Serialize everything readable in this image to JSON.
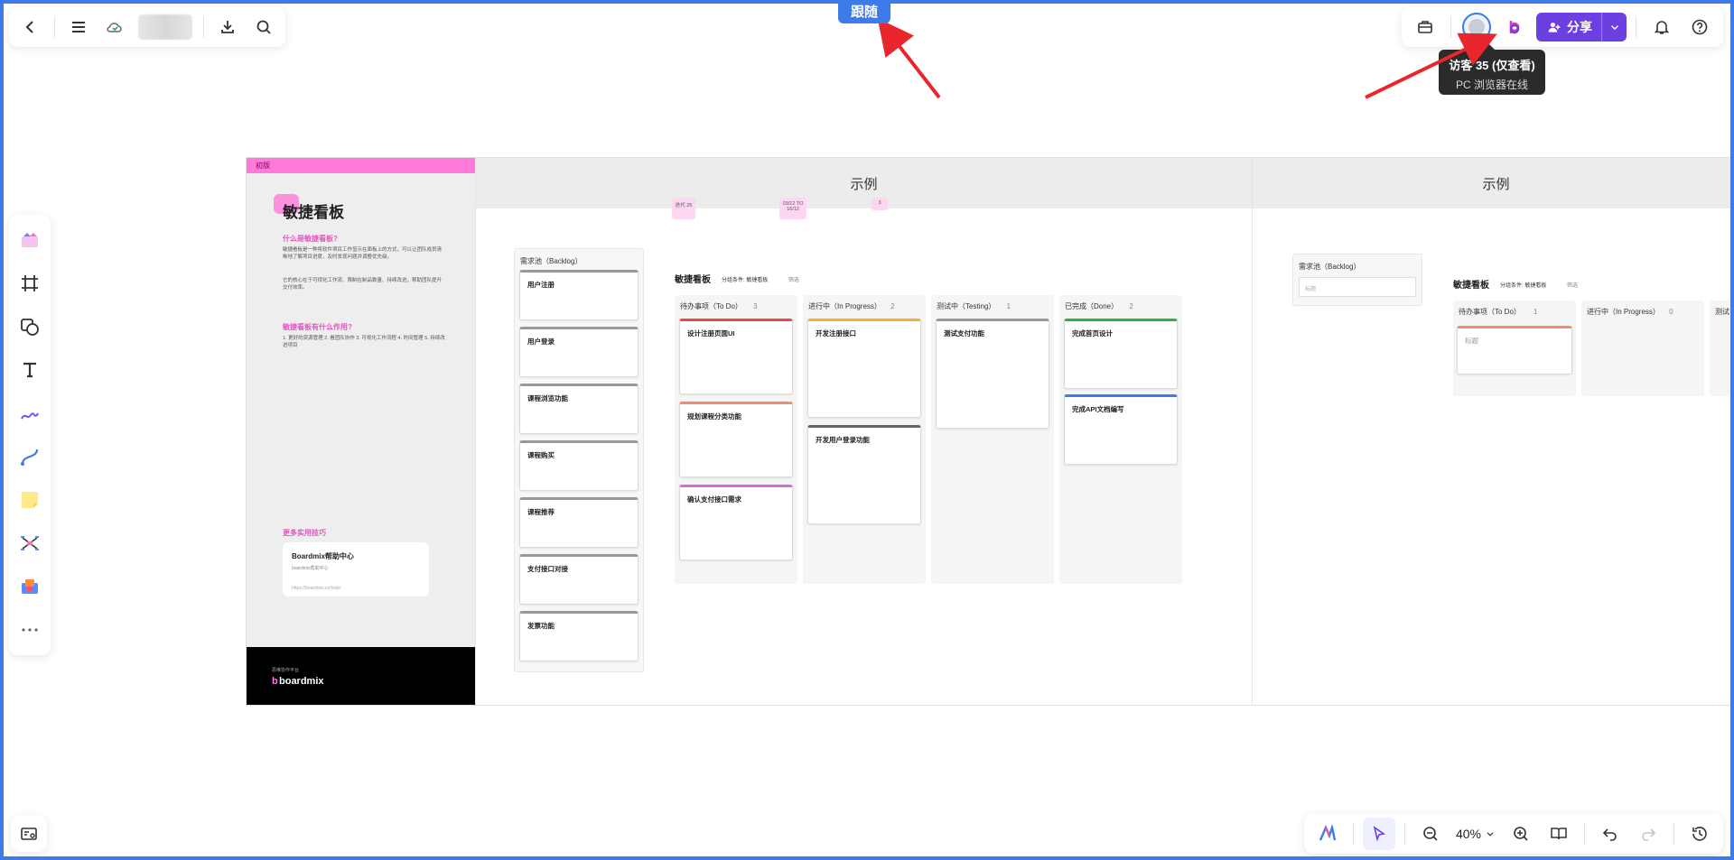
{
  "follow_label": "跟随",
  "top_bar": {
    "back_icon": "arrow-left-icon",
    "menu_icon": "hamburger-icon",
    "cloud_icon": "cloud-check-icon",
    "export_icon": "download-icon",
    "search_icon": "search-icon"
  },
  "top_right": {
    "share_label": "分享",
    "tooltip_title": "访客 35 (仅查看)",
    "tooltip_sub": "PC 浏览器在线"
  },
  "bottom_right": {
    "zoom": "40%"
  },
  "board": {
    "intro": {
      "header_tag": "初版",
      "title": "敏捷看板",
      "sec1": "什么是敏捷看板?",
      "para1": "敏捷看板是一种将软件项目工作显示在面板上的方式，可以让团队成员清晰地了解项目进度，及时发现问题并调整优先级。",
      "para2": "它的核心在于可视化工作流、限制在制品数量、持续改进，帮助团队提升交付效率。",
      "sec2": "敏捷看板有什么作用?",
      "para3": "1. 更好的资源管理 2. 看团队协作 3. 可视化工作流程 4. 时间管理 5. 持续改进项目",
      "sec3": "更多实用技巧",
      "help_title": "Boardmix帮助中心",
      "help_sub": "boardmix帮助中心",
      "help_link": "https://boardmix.cn/help/",
      "footer_small": "思维协作平台",
      "footer_brand": "boardmix"
    },
    "section_title_1": "示例",
    "section_title_2": "示例",
    "backlog_title": "需求池（Backlog）",
    "kanban_title": "敏捷看板",
    "group_label": "分组条件: 敏捷看板",
    "filter_label": "筛选",
    "lane_todo": "待办事项（To Do）",
    "lane_todo_count": "3",
    "lane_inprogress": "进行中（In Progress）",
    "lane_inprogress_count": "2",
    "lane_testing": "测试中（Testing）",
    "lane_testing_count": "1",
    "lane_done": "已完成（Done）",
    "lane_done_count": "2",
    "backlog_cards": [
      "用户注册",
      "用户登录",
      "课程浏览功能",
      "课程购买",
      "课程推荐",
      "支付接口对接",
      "发票功能"
    ],
    "todo_cards": [
      "设计注册页面UI",
      "规划课程分类功能",
      "确认支付接口需求"
    ],
    "inprogress_cards": [
      "开发注册接口",
      "开发用户登录功能"
    ],
    "testing_cards": [
      "测试支付功能"
    ],
    "done_cards": [
      "完成首页设计",
      "完成API文档编写"
    ],
    "pink_1": "迭代 25",
    "pink_2": "03/12 TO 16/12",
    "pink_3": "3",
    "backlog2_title": "需求池（Backlog）",
    "backlog2_placeholder": "标题",
    "kanban2_title": "敏捷看板",
    "group2_label": "分组条件: 敏捷看板",
    "filter2_label": "筛选",
    "lane2_todo": "待办事项（To Do）",
    "lane2_todo_count": "1",
    "lane2_inprogress": "进行中（In Progress）",
    "lane2_inprogress_count": "0",
    "lane2_testing": "测试",
    "todo2_card": "标题"
  }
}
